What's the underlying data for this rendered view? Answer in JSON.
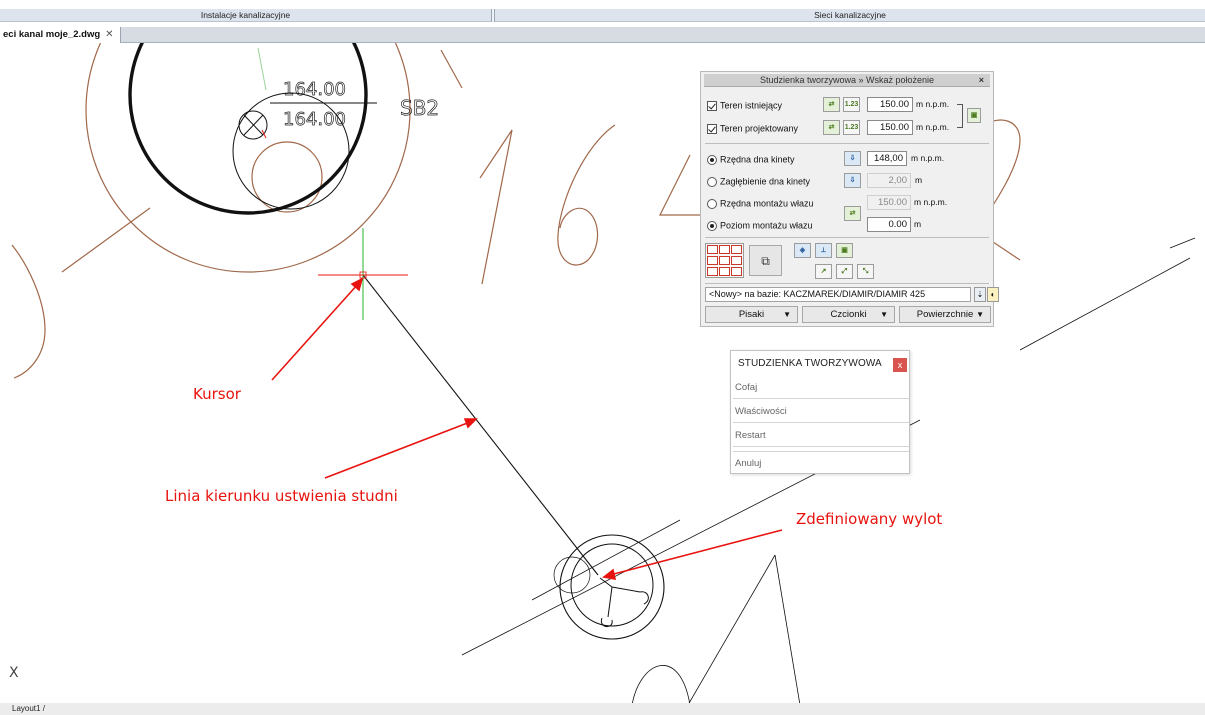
{
  "ribbon": {
    "left_label": "Instalacje kanalizacyjne",
    "right_label": "Sieci kanalizacyjne"
  },
  "document_tab": {
    "label": "eci kanal moje_2.dwg",
    "close": "✕"
  },
  "drawing": {
    "elevation_top": "164.00",
    "elevation_bottom": "164.00",
    "node_name": "SB2",
    "colors": {
      "terrain": "#a0684a",
      "geometry": "#111111",
      "cursor": "#e8130e",
      "axis": "#27b52a"
    }
  },
  "annotations": {
    "kursor": "Kursor",
    "linia": "Linia kierunku ustwienia studni",
    "wylot": "Zdefiniowany wylot"
  },
  "ucs_label": "X",
  "status_bar": {
    "layout_tab": "Layout1"
  },
  "panel": {
    "title": "Studzienka tworzywowa » Wskaż położenie",
    "close": "×",
    "teren_istniejacy": {
      "label": "Teren istniejący",
      "value": "150.00",
      "unit": "m n.p.m.",
      "checked": true
    },
    "teren_projektowany": {
      "label": "Teren projektowany",
      "value": "150.00",
      "unit": "m n.p.m.",
      "checked": true
    },
    "rzedna_dna": {
      "label": "Rzędna dna kinety",
      "value": "148,00",
      "unit": "m n.p.m.",
      "selected": true
    },
    "zaglebienie": {
      "label": "Zagłębienie dna kinety",
      "value": "2,00",
      "unit": "m",
      "selected": false
    },
    "rzedna_wlazu": {
      "label": "Rzędna montażu włazu",
      "value": "150.00",
      "unit": "m n.p.m.",
      "selected": false
    },
    "poziom_wlazu": {
      "label": "Poziom montażu włazu",
      "value": "0.00",
      "unit": "m",
      "selected": true
    },
    "icon_text": "1.23",
    "base_combo": "<Nowy> na bazie: KACZMAREK/DIAMIR/DIAMIR 425",
    "dropdowns": [
      "Pisaki",
      "Czcionki",
      "Powierzchnie"
    ],
    "dropdown_arrow": "▼"
  },
  "context_menu": {
    "title": "STUDZIENKA TWORZYWOWA",
    "close": "x",
    "items": [
      "Cofaj",
      "Właściwości",
      "Restart",
      "Anuluj"
    ]
  }
}
